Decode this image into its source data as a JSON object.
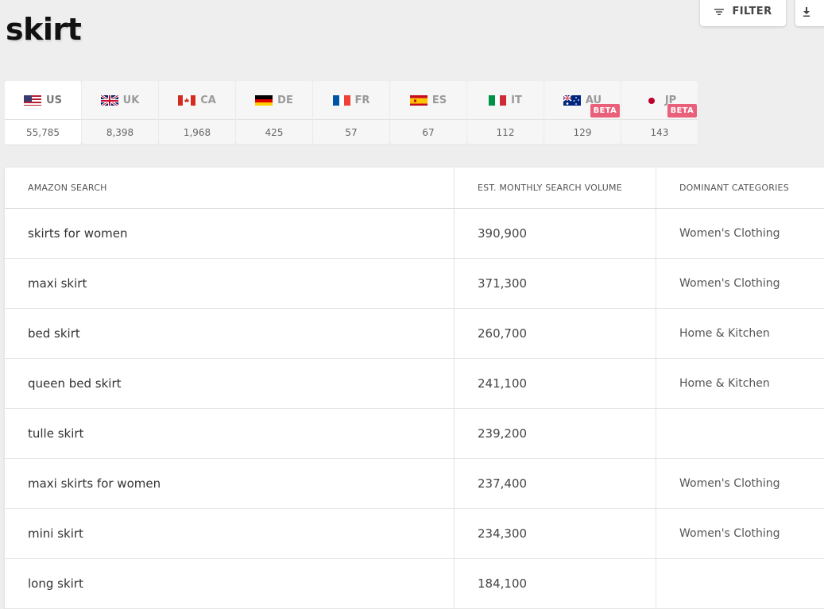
{
  "page": {
    "title": "skirt"
  },
  "toolbar": {
    "filter_label": "FILTER"
  },
  "markets": [
    {
      "code": "US",
      "count": "55,785",
      "flag": "us-flag",
      "active": true
    },
    {
      "code": "UK",
      "count": "8,398",
      "flag": "uk-flag"
    },
    {
      "code": "CA",
      "count": "1,968",
      "flag": "ca-flag"
    },
    {
      "code": "DE",
      "count": "425",
      "flag": "de-flag"
    },
    {
      "code": "FR",
      "count": "57",
      "flag": "fr-flag"
    },
    {
      "code": "ES",
      "count": "67",
      "flag": "es-flag"
    },
    {
      "code": "IT",
      "count": "112",
      "flag": "it-flag"
    },
    {
      "code": "AU",
      "count": "129",
      "flag": "au-flag",
      "badge": "BETA"
    },
    {
      "code": "JP",
      "count": "143",
      "flag": "jp-flag",
      "badge": "BETA"
    }
  ],
  "table": {
    "headers": [
      "AMAZON SEARCH",
      "EST. MONTHLY SEARCH VOLUME",
      "DOMINANT CATEGORIES"
    ],
    "rows": [
      {
        "search": "skirts for women",
        "volume": "390,900",
        "category": "Women's Clothing"
      },
      {
        "search": "maxi skirt",
        "volume": "371,300",
        "category": "Women's Clothing"
      },
      {
        "search": "bed skirt",
        "volume": "260,700",
        "category": "Home & Kitchen"
      },
      {
        "search": "queen bed skirt",
        "volume": "241,100",
        "category": "Home & Kitchen"
      },
      {
        "search": "tulle skirt",
        "volume": "239,200",
        "category": ""
      },
      {
        "search": "maxi skirts for women",
        "volume": "237,400",
        "category": "Women's Clothing"
      },
      {
        "search": "mini skirt",
        "volume": "234,300",
        "category": "Women's Clothing"
      },
      {
        "search": "long skirt",
        "volume": "184,100",
        "category": ""
      }
    ]
  },
  "colors": {
    "badge": "#ea5f79",
    "background": "#eeeeee"
  },
  "icons": {
    "filter": "filter-icon",
    "download": "download-icon"
  }
}
